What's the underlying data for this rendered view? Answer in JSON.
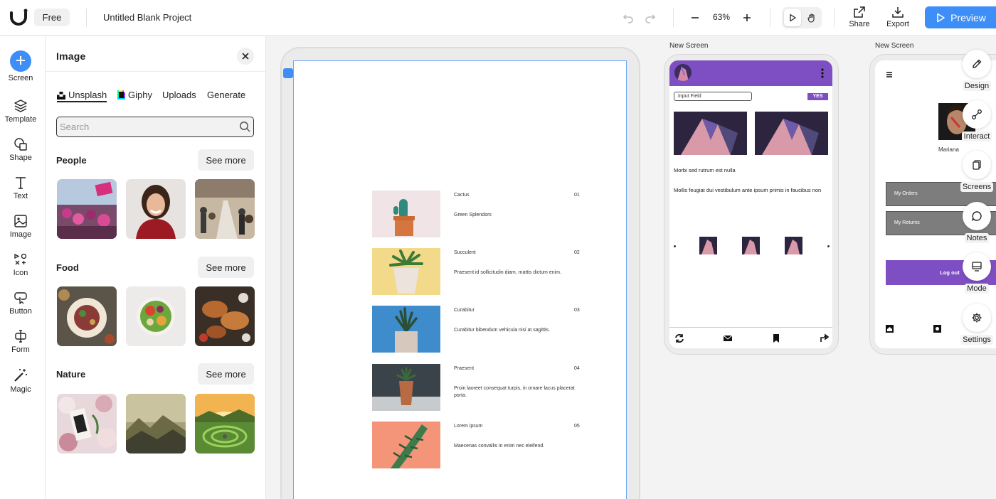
{
  "header": {
    "plan": "Free",
    "project_title": "Untitled Blank Project",
    "zoom": "63%",
    "share_label": "Share",
    "export_label": "Export",
    "preview_label": "Preview",
    "accent_color": "#3e8ef7"
  },
  "rail": {
    "items": [
      {
        "label": "Screen",
        "icon": "plus-icon"
      },
      {
        "label": "Template",
        "icon": "layers-icon"
      },
      {
        "label": "Shape",
        "icon": "shape-icon"
      },
      {
        "label": "Text",
        "icon": "text-icon"
      },
      {
        "label": "Image",
        "icon": "image-icon"
      },
      {
        "label": "Icon",
        "icon": "icons-icon"
      },
      {
        "label": "Button",
        "icon": "button-icon"
      },
      {
        "label": "Form",
        "icon": "form-icon"
      },
      {
        "label": "Magic",
        "icon": "magic-wand-icon"
      }
    ]
  },
  "panel": {
    "title": "Image",
    "tabs": [
      "Unsplash",
      "Giphy",
      "Uploads",
      "Generate"
    ],
    "active_tab": "Unsplash",
    "search_placeholder": "Search",
    "sections": [
      {
        "title": "People",
        "see_more": "See more"
      },
      {
        "title": "Food",
        "see_more": "See more"
      },
      {
        "title": "Nature",
        "see_more": "See more"
      }
    ]
  },
  "artboard": {
    "items": [
      {
        "name": "Cactus",
        "num": "01",
        "desc": "Green Splendors"
      },
      {
        "name": "Succulent",
        "num": "02",
        "desc": "Praesent id sollicitudin diam, mattis dictum enim."
      },
      {
        "name": "Curabitur",
        "num": "03",
        "desc": "Curabitur bibendum vehicula nisi at sagittis."
      },
      {
        "name": "Praesent",
        "num": "04",
        "desc": "Proin laoreet consequat turpis, in ornare lacus placerat porta."
      },
      {
        "name": "Lorem ipsum",
        "num": "05",
        "desc": "Maecenas convallis in enim nec eleifend."
      }
    ]
  },
  "screen2": {
    "label": "New Screen",
    "input_label": "Input Field",
    "yes_label": "YES",
    "text1": "Morbi sed rutrum est nulla",
    "text2": "Mollis feugiat dui vestibulum ante ipsum primis in faucibus non",
    "header_color": "#7e4fc2"
  },
  "screen3": {
    "label": "New Screen",
    "user_name": "Mariana",
    "btn1": "My Orders",
    "btn2": "My Returns",
    "logout": "Log out"
  },
  "right_tools": [
    {
      "label": "Design",
      "icon": "pencil-icon"
    },
    {
      "label": "Interact",
      "icon": "interact-icon"
    },
    {
      "label": "Screens",
      "icon": "screens-icon"
    },
    {
      "label": "Notes",
      "icon": "notes-icon"
    },
    {
      "label": "Mode",
      "icon": "mode-icon"
    },
    {
      "label": "Settings",
      "icon": "gear-icon"
    }
  ]
}
